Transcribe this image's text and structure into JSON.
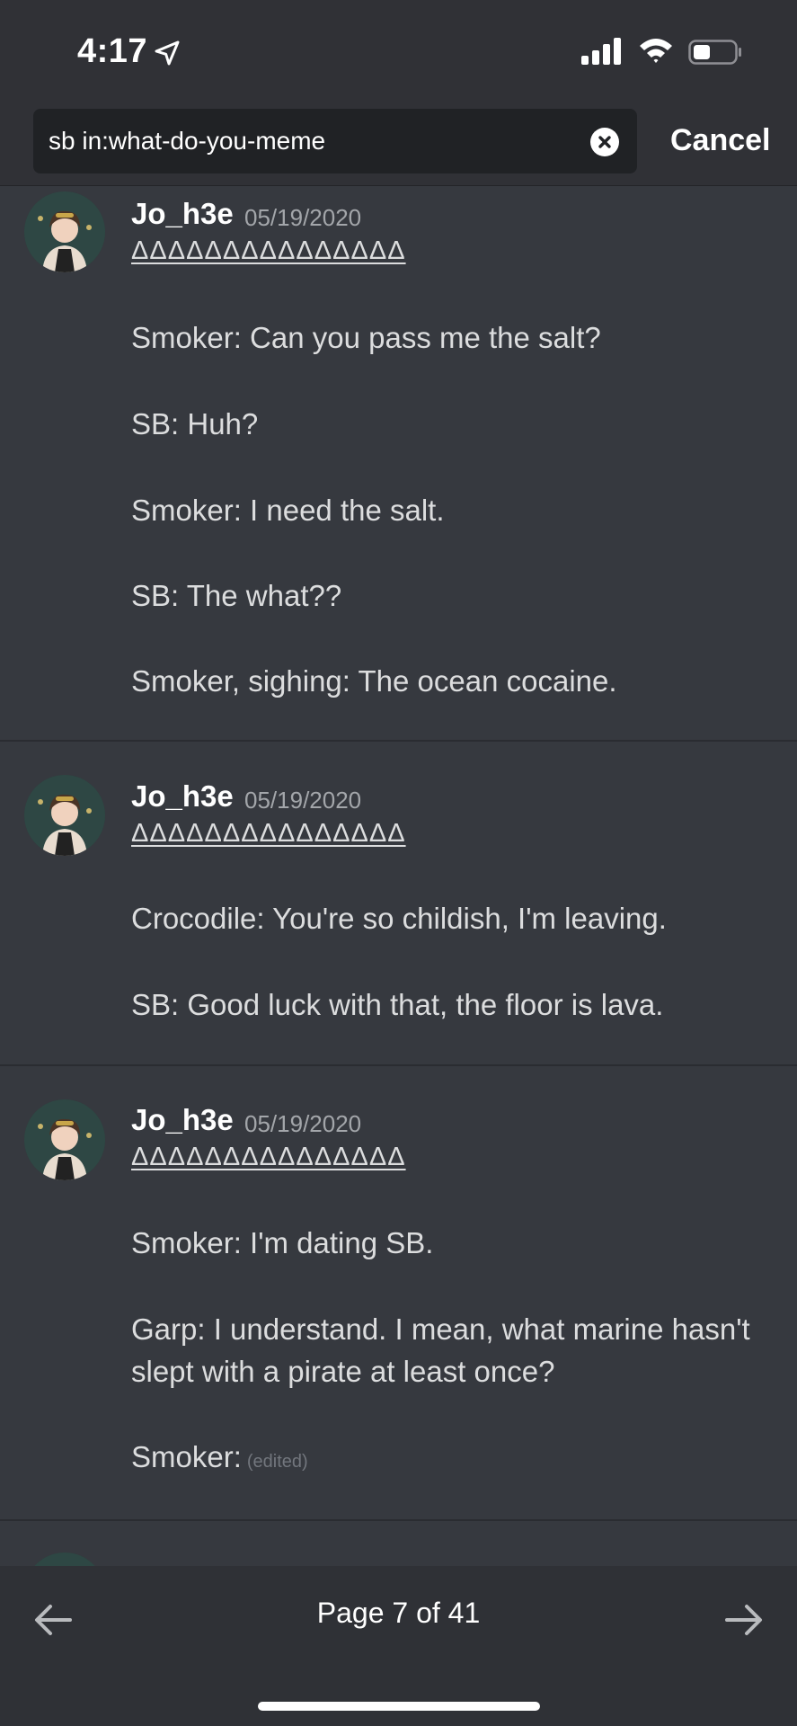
{
  "status": {
    "time": "4:17"
  },
  "search": {
    "query": "sb in:what-do-you-meme",
    "cancel_label": "Cancel"
  },
  "messages": [
    {
      "author": "Jo_h3e",
      "timestamp": "05/19/2020",
      "deltas": "ΔΔΔΔΔΔΔΔΔΔΔΔΔΔΔ",
      "lines": [
        "Smoker: Can you pass me the salt?",
        "SB: Huh?",
        "Smoker: I need the salt.",
        "SB: The what??",
        "Smoker, sighing: The ocean cocaine."
      ]
    },
    {
      "author": "Jo_h3e",
      "timestamp": "05/19/2020",
      "deltas": "ΔΔΔΔΔΔΔΔΔΔΔΔΔΔΔ",
      "lines": [
        "Crocodile: You're so childish, I'm leaving.",
        "SB: Good luck with that, the floor is lava."
      ]
    },
    {
      "author": "Jo_h3e",
      "timestamp": "05/19/2020",
      "deltas": "ΔΔΔΔΔΔΔΔΔΔΔΔΔΔΔ",
      "lines": [
        "Smoker: I'm dating SB.",
        "Garp: I understand. I mean, what marine hasn't",
        "slept with a pirate at least once?",
        "Smoker:"
      ],
      "edited_label": "(edited)"
    }
  ],
  "pagination": {
    "label": "Page 7 of 41"
  }
}
